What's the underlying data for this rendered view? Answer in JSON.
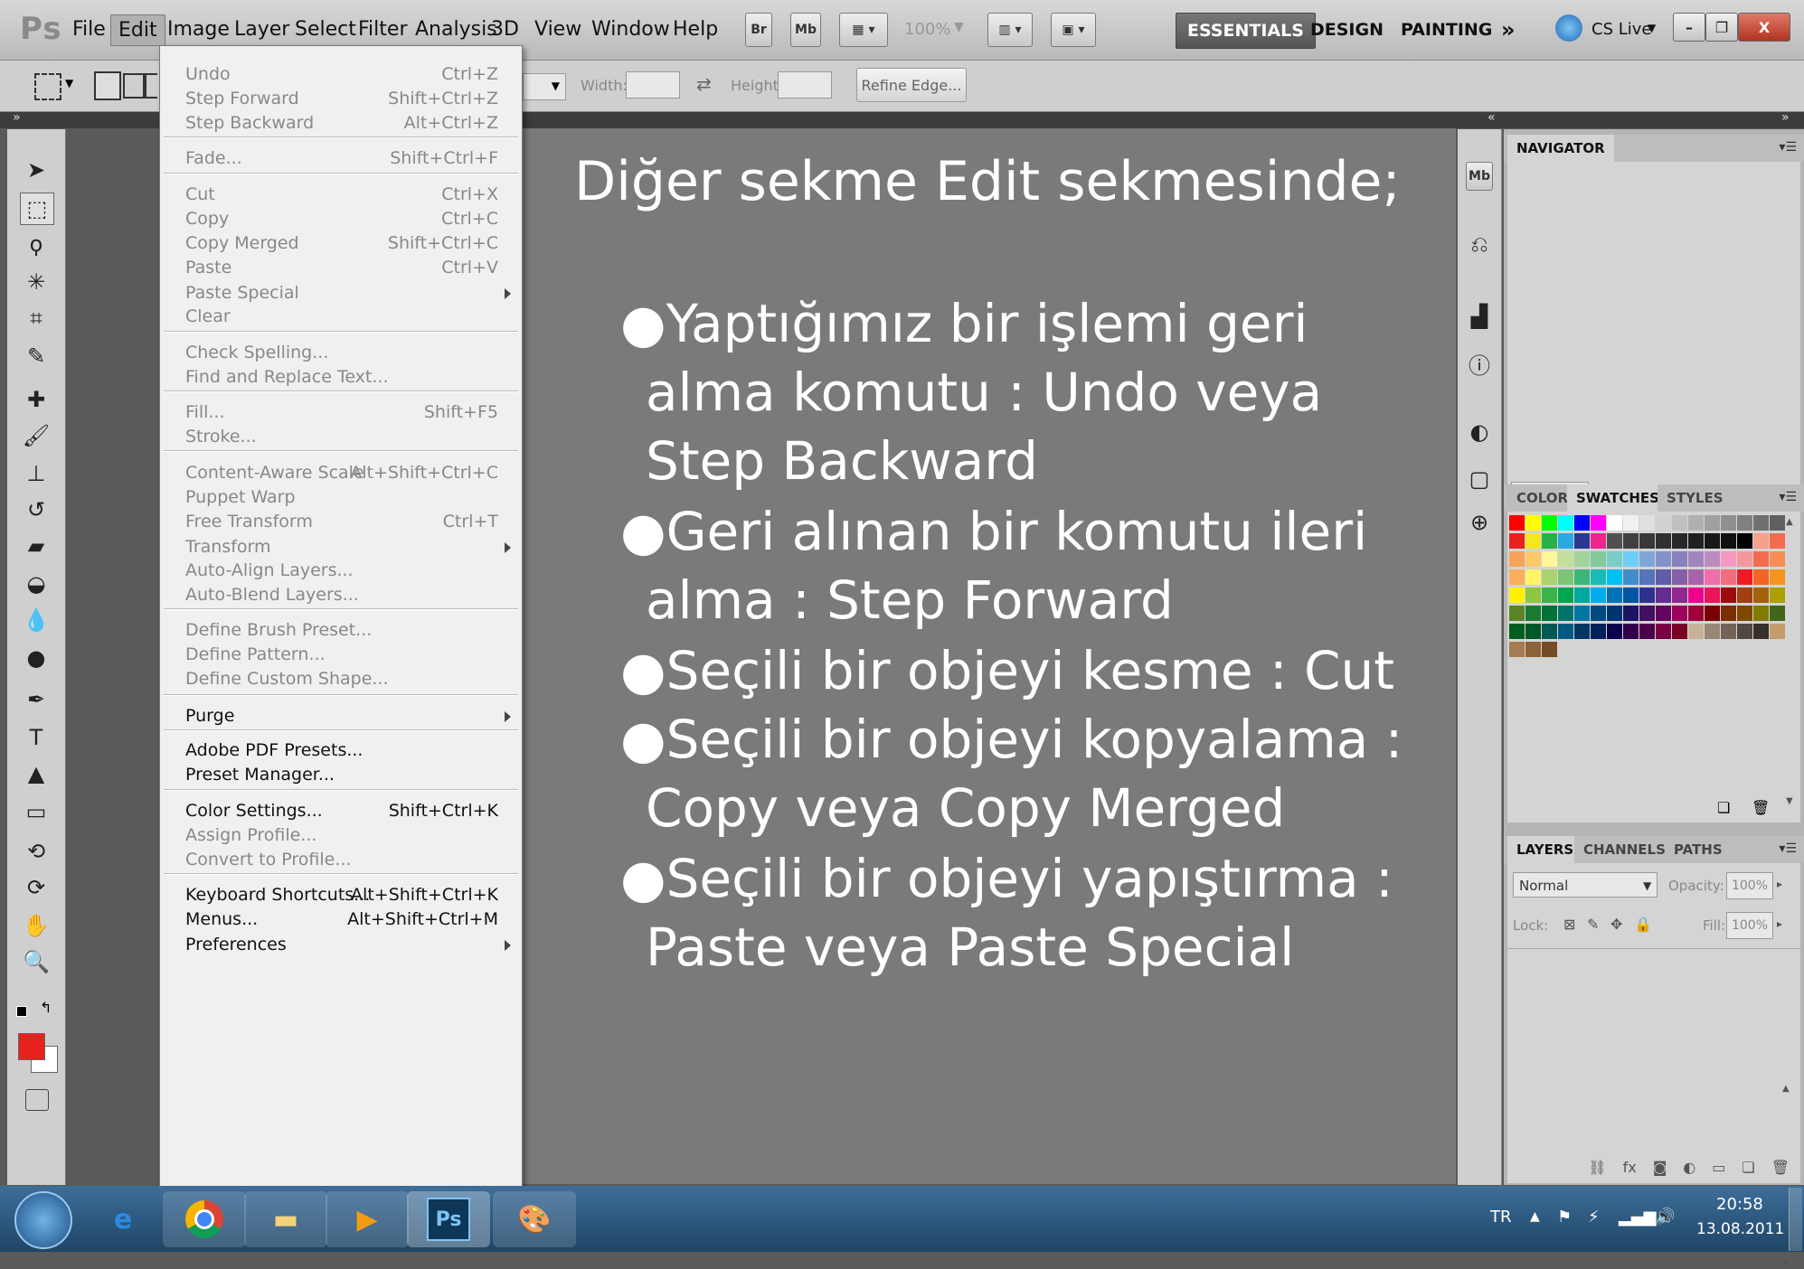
{
  "app": {
    "logo": "Ps"
  },
  "menubar": {
    "items": [
      "File",
      "Edit",
      "Image",
      "Layer",
      "Select",
      "Filter",
      "Analysis",
      "3D",
      "View",
      "Window",
      "Help"
    ],
    "active": "Edit",
    "bridge_btn": "Br",
    "minibridge_btn": "Mb",
    "zoom_value": "100%",
    "workspaces": [
      "ESSENTIALS",
      "DESIGN",
      "PAINTING"
    ],
    "more_workspaces": "»",
    "cs_live": "CS Live",
    "window_buttons": [
      "–",
      "❐",
      "X"
    ]
  },
  "options_bar": {
    "width_label": "Width:",
    "height_label": "Height:",
    "swap_icon": "⇄",
    "refine_edge": "Refine Edge..."
  },
  "edit_menu": {
    "items": [
      {
        "label": "Undo",
        "shortcut": "Ctrl+Z",
        "enabled": false
      },
      {
        "label": "Step Forward",
        "shortcut": "Shift+Ctrl+Z",
        "enabled": false
      },
      {
        "label": "Step Backward",
        "shortcut": "Alt+Ctrl+Z",
        "enabled": false
      },
      {
        "label": "Fade...",
        "shortcut": "Shift+Ctrl+F",
        "enabled": false
      },
      {
        "label": "Cut",
        "shortcut": "Ctrl+X",
        "enabled": false
      },
      {
        "label": "Copy",
        "shortcut": "Ctrl+C",
        "enabled": false
      },
      {
        "label": "Copy Merged",
        "shortcut": "Shift+Ctrl+C",
        "enabled": false
      },
      {
        "label": "Paste",
        "shortcut": "Ctrl+V",
        "enabled": false
      },
      {
        "label": "Paste Special",
        "shortcut": "",
        "enabled": false,
        "submenu": true
      },
      {
        "label": "Clear",
        "shortcut": "",
        "enabled": false
      },
      {
        "label": "Check Spelling...",
        "shortcut": "",
        "enabled": false
      },
      {
        "label": "Find and Replace Text...",
        "shortcut": "",
        "enabled": false
      },
      {
        "label": "Fill...",
        "shortcut": "Shift+F5",
        "enabled": false
      },
      {
        "label": "Stroke...",
        "shortcut": "",
        "enabled": false
      },
      {
        "label": "Content-Aware Scale",
        "shortcut": "Alt+Shift+Ctrl+C",
        "enabled": false
      },
      {
        "label": "Puppet Warp",
        "shortcut": "",
        "enabled": false
      },
      {
        "label": "Free Transform",
        "shortcut": "Ctrl+T",
        "enabled": false
      },
      {
        "label": "Transform",
        "shortcut": "",
        "enabled": false,
        "submenu": true
      },
      {
        "label": "Auto-Align Layers...",
        "shortcut": "",
        "enabled": false
      },
      {
        "label": "Auto-Blend Layers...",
        "shortcut": "",
        "enabled": false
      },
      {
        "label": "Define Brush Preset...",
        "shortcut": "",
        "enabled": false
      },
      {
        "label": "Define Pattern...",
        "shortcut": "",
        "enabled": false
      },
      {
        "label": "Define Custom Shape...",
        "shortcut": "",
        "enabled": false
      },
      {
        "label": "Purge",
        "shortcut": "",
        "enabled": true,
        "submenu": true
      },
      {
        "label": "Adobe PDF Presets...",
        "shortcut": "",
        "enabled": true
      },
      {
        "label": "Preset Manager...",
        "shortcut": "",
        "enabled": true
      },
      {
        "label": "Color Settings...",
        "shortcut": "Shift+Ctrl+K",
        "enabled": true
      },
      {
        "label": "Assign Profile...",
        "shortcut": "",
        "enabled": false
      },
      {
        "label": "Convert to Profile...",
        "shortcut": "",
        "enabled": false
      },
      {
        "label": "Keyboard Shortcuts...",
        "shortcut": "Alt+Shift+Ctrl+K",
        "enabled": true
      },
      {
        "label": "Menus...",
        "shortcut": "Alt+Shift+Ctrl+M",
        "enabled": true
      },
      {
        "label": "Preferences",
        "shortcut": "",
        "enabled": true,
        "submenu": true
      }
    ]
  },
  "slide": {
    "title": "Diğer sekme Edit sekmesinde;",
    "bullets": [
      [
        "●Yaptığımız bir işlemi geri",
        "alma komutu : Undo veya",
        "Step Backward"
      ],
      [
        "●Geri alınan bir komutu ileri",
        "alma : Step Forward"
      ],
      [
        "●Seçili bir objeyi kesme : Cut"
      ],
      [
        "●Seçili bir objeyi kopyalama :",
        "Copy veya Copy Merged"
      ],
      [
        "●Seçili bir objeyi yapıştırma :",
        "Paste veya Paste Special"
      ]
    ]
  },
  "panels": {
    "navigator": {
      "tab": "NAVIGATOR"
    },
    "color_group": {
      "tabs": [
        "COLOR",
        "SWATCHES",
        "STYLES"
      ],
      "selected": "SWATCHES"
    },
    "layers_group": {
      "tabs": [
        "LAYERS",
        "CHANNELS",
        "PATHS"
      ],
      "selected": "LAYERS",
      "blend_mode": "Normal",
      "opacity_label": "Opacity:",
      "opacity_value": "100%",
      "lock_label": "Lock:",
      "fill_label": "Fill:",
      "fill_value": "100%"
    }
  },
  "dock_icons": [
    "Mb",
    "history-icon",
    "histogram-icon",
    "info-icon",
    "adjustments-icon",
    "masks-icon",
    "clone-source-icon"
  ],
  "taskbar": {
    "language": "TR",
    "time": "20:58",
    "date": "13.08.2011",
    "apps": [
      "windows-start",
      "internet-explorer",
      "chrome",
      "file-explorer",
      "media-player",
      "photoshop",
      "paint"
    ]
  },
  "colors": {
    "foreground": "#e8211e",
    "background": "#ffffff",
    "canvas": "#7a7a7a",
    "menu_bg": "#f0f0f0",
    "swatch_rows": [
      [
        "#ff0000",
        "#ffff00",
        "#00ff00",
        "#00ffff",
        "#0000ff",
        "#ff00ff",
        "#ffffff",
        "#f0f0f0",
        "#e0e0e0",
        "#d0d0d0",
        "#c0c0c0",
        "#b0b0b0",
        "#a0a0a0",
        "#909090",
        "#808080",
        "#707070",
        "#606060"
      ],
      [
        "#e8211e",
        "#f5e71f",
        "#27b14a",
        "#29a9e0",
        "#2c3791",
        "#ec268f",
        "#505050",
        "#404040",
        "#383838",
        "#303030",
        "#282828",
        "#202020",
        "#181818",
        "#101010",
        "#000000",
        "#f7a08a",
        "#f36c4f"
      ],
      [
        "#f7a35b",
        "#fbc96a",
        "#fff799",
        "#c4df9b",
        "#a3d39c",
        "#82ca9c",
        "#7bcdc8",
        "#6ecff6",
        "#7ea7d8",
        "#8393ca",
        "#8781bd",
        "#a186be",
        "#bd8cbf",
        "#f49ac1",
        "#f5989d",
        "#f26c4f",
        "#f68e55"
      ],
      [
        "#fbaf5c",
        "#fff467",
        "#acd372",
        "#7cc576",
        "#3bb878",
        "#1abbb4",
        "#00bff3",
        "#438ccb",
        "#5574b9",
        "#605ca8",
        "#855fa8",
        "#a763a8",
        "#f06ea9",
        "#f26d7d",
        "#ed1c24",
        "#f26522",
        "#f7941d"
      ],
      [
        "#fff200",
        "#8dc63f",
        "#39b54a",
        "#00a651",
        "#00a99d",
        "#00aeef",
        "#0072bc",
        "#0054a6",
        "#2e3192",
        "#662d91",
        "#92278f",
        "#ec008c",
        "#ed145b",
        "#9e0b0f",
        "#a0410d",
        "#a3620a",
        "#aba000"
      ],
      [
        "#598527",
        "#197b30",
        "#007236",
        "#00746b",
        "#0076a3",
        "#004a80",
        "#003471",
        "#1b1464",
        "#440e62",
        "#630460",
        "#9e005d",
        "#9e0039",
        "#790000",
        "#7b2e00",
        "#7d4900",
        "#827b00",
        "#406618"
      ],
      [
        "#005e20",
        "#005826",
        "#005952",
        "#005b7f",
        "#003663",
        "#002157",
        "#0d004c",
        "#32004b",
        "#4b0049",
        "#7b0046",
        "#7a0026",
        "#c7b299",
        "#998675",
        "#736357",
        "#534741",
        "#37302d",
        "#c69c6d"
      ],
      [
        "#a67c52",
        "#8c6239",
        "#754c24"
      ]
    ]
  }
}
